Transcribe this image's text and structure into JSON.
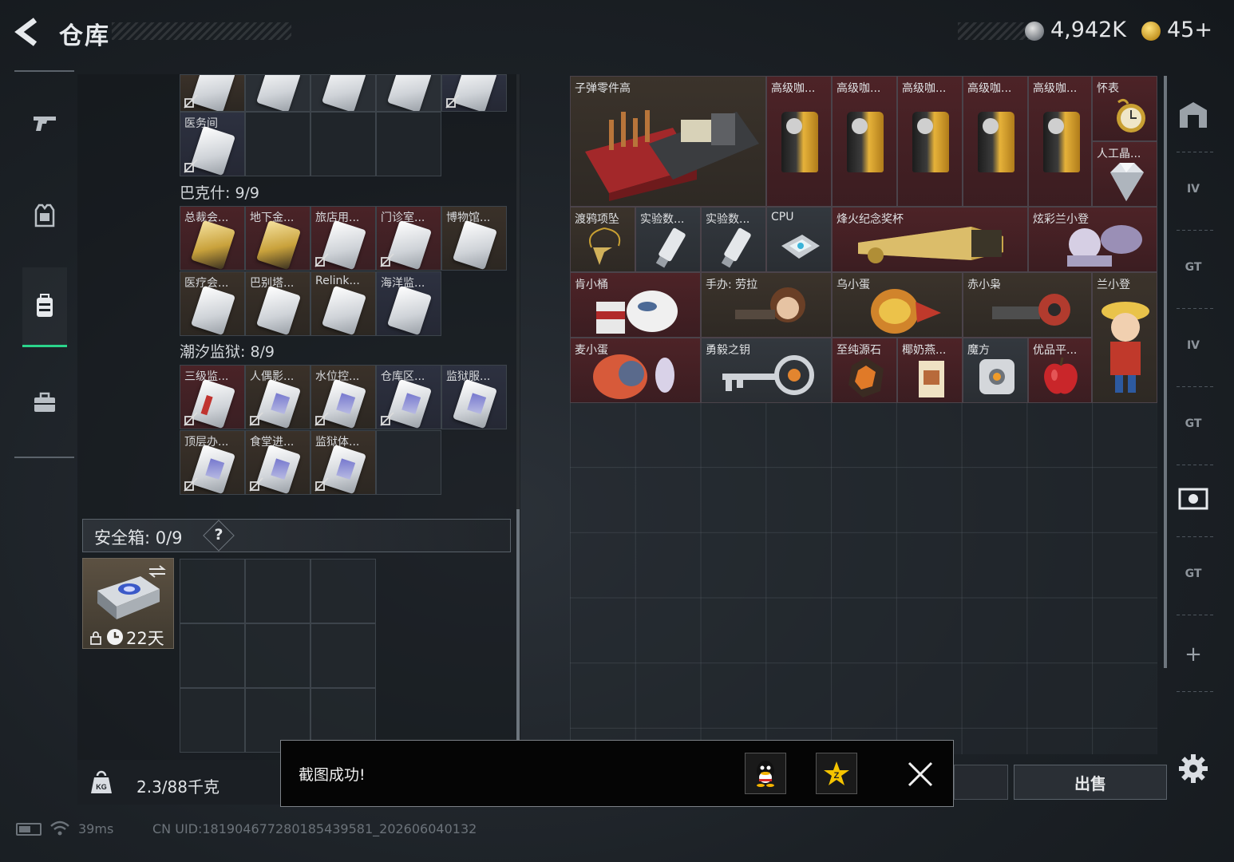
{
  "header": {
    "title": "仓库",
    "currency_silver": "4,942K",
    "currency_gold": "45+"
  },
  "nav": {
    "items": [
      {
        "name": "weapons",
        "icon": "gun-icon",
        "active": false
      },
      {
        "name": "equipment",
        "icon": "vest-icon",
        "active": false
      },
      {
        "name": "backpack",
        "icon": "backpack-icon",
        "active": true
      },
      {
        "name": "supplies",
        "icon": "briefcase-icon",
        "active": false
      }
    ]
  },
  "left": {
    "top_row_labels": [
      "",
      "",
      "",
      "",
      ""
    ],
    "top_label": "医务间",
    "section_bakeshi": "巴克什: 9/9",
    "bakeshi_row1": [
      "总裁会...",
      "地下金...",
      "旅店用...",
      "门诊室...",
      "博物馆..."
    ],
    "bakeshi_row2": [
      "医疗会...",
      "巴别塔...",
      "Relink...",
      "海洋监..."
    ],
    "section_chaoxi": "潮汐监狱: 8/9",
    "chaoxi_row1": [
      "三级监...",
      "人偶影...",
      "水位控...",
      "仓库区...",
      "监狱服..."
    ],
    "chaoxi_row2": [
      "顶层办...",
      "食堂进...",
      "监狱体..."
    ],
    "safe_label": "安全箱: 0/9",
    "safe_help": "?",
    "safe_days": "22天",
    "weight": "2.3/88千克"
  },
  "right": {
    "items": {
      "bullet_parts": "子弹零件高",
      "coffee": [
        "高级咖...",
        "高级咖...",
        "高级咖...",
        "高级咖...",
        "高级咖..."
      ],
      "pocket_watch": "怀表",
      "diamond": "人工晶...",
      "raven": "渡鸦项坠",
      "usb1": "实验数...",
      "usb2": "实验数...",
      "cpu": "CPU",
      "trophy": "烽火纪念奖杯",
      "colorful": "炫彩兰小登",
      "kfc": "肯小桶",
      "lara": "手办: 劳拉",
      "wu": "乌小蛋",
      "chi": "赤小枭",
      "lan": "兰小登",
      "mai": "麦小蛋",
      "key": "勇毅之钥",
      "stone": "至纯源石",
      "coconut": "椰奶燕...",
      "cube": "魔方",
      "apple": "优品平..."
    },
    "rail_tags": [
      "IV",
      "GT",
      "IV",
      "GT",
      "",
      "GT"
    ],
    "sell_label": "出售"
  },
  "toast": {
    "message": "截图成功!"
  },
  "status": {
    "ping": "39ms",
    "uid": "CN UID:181904677280185439581_202606040132"
  },
  "colors": {
    "accent_green": "#2bd48b",
    "rare_red": "#4d2327",
    "gold_tier": "#3b332b"
  }
}
